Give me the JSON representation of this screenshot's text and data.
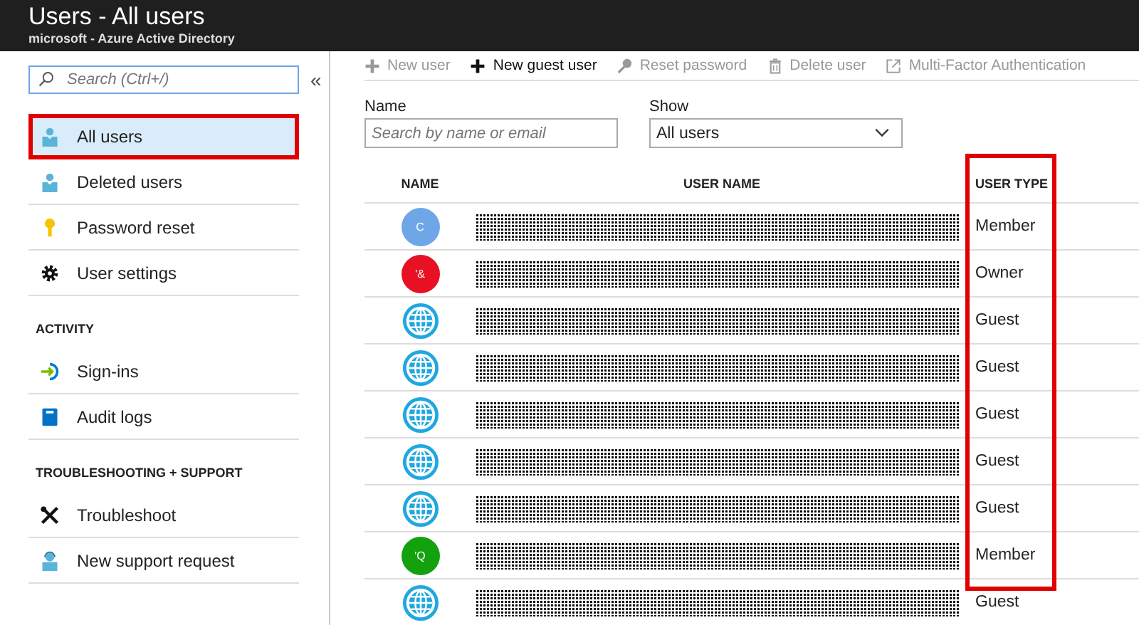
{
  "window": {
    "title": "Users - All users",
    "subtitle": "microsoft - Azure Active Directory"
  },
  "sidebar": {
    "search": {
      "placeholder": "Search (Ctrl+/)"
    },
    "collapse": "«",
    "sections": [
      {
        "items": [
          {
            "label": "All users",
            "selected": true,
            "highlighted": true
          },
          {
            "label": "Deleted users",
            "selected": false,
            "highlighted": false
          },
          {
            "label": "Password reset",
            "selected": false,
            "highlighted": false
          },
          {
            "label": "User settings",
            "selected": false,
            "highlighted": false
          }
        ]
      },
      {
        "heading": "ACTIVITY",
        "items": [
          {
            "label": "Sign-ins",
            "selected": false,
            "highlighted": false
          },
          {
            "label": "Audit logs",
            "selected": false,
            "highlighted": false
          }
        ]
      },
      {
        "heading": "TROUBLESHOOTING + SUPPORT",
        "items": [
          {
            "label": "Troubleshoot",
            "selected": false,
            "highlighted": false
          },
          {
            "label": "New support request",
            "selected": false,
            "highlighted": false
          }
        ]
      }
    ]
  },
  "toolbar": [
    {
      "label": "New user",
      "disabled": true
    },
    {
      "label": "New guest user",
      "disabled": false
    },
    {
      "label": "Reset password",
      "disabled": true
    },
    {
      "label": "Delete user",
      "disabled": true
    },
    {
      "label": "Multi-Factor Authentication",
      "disabled": true
    }
  ],
  "filters": {
    "name": {
      "label": "Name",
      "placeholder": "Search by name or email"
    },
    "show": {
      "label": "Show",
      "value": "All users"
    }
  },
  "table": {
    "columns": [
      {
        "label": "NAME",
        "highlighted": false
      },
      {
        "label": "USER NAME",
        "highlighted": false
      },
      {
        "label": "USER TYPE",
        "highlighted": true
      }
    ],
    "rows": [
      {
        "avatar": {
          "kind": "initial",
          "initial": "C",
          "color": "#6ea6e8"
        },
        "user_type": "Member"
      },
      {
        "avatar": {
          "kind": "initial",
          "initial": "'&",
          "color": "#e81123"
        },
        "user_type": "Owner"
      },
      {
        "avatar": {
          "kind": "guest"
        },
        "user_type": "Guest"
      },
      {
        "avatar": {
          "kind": "guest"
        },
        "user_type": "Guest"
      },
      {
        "avatar": {
          "kind": "guest"
        },
        "user_type": "Guest"
      },
      {
        "avatar": {
          "kind": "guest"
        },
        "user_type": "Guest"
      },
      {
        "avatar": {
          "kind": "guest"
        },
        "user_type": "Guest"
      },
      {
        "avatar": {
          "kind": "initial",
          "initial": "'Q",
          "color": "#13a10e"
        },
        "user_type": "Member"
      },
      {
        "avatar": {
          "kind": "guest"
        },
        "user_type": "Guest"
      }
    ]
  }
}
